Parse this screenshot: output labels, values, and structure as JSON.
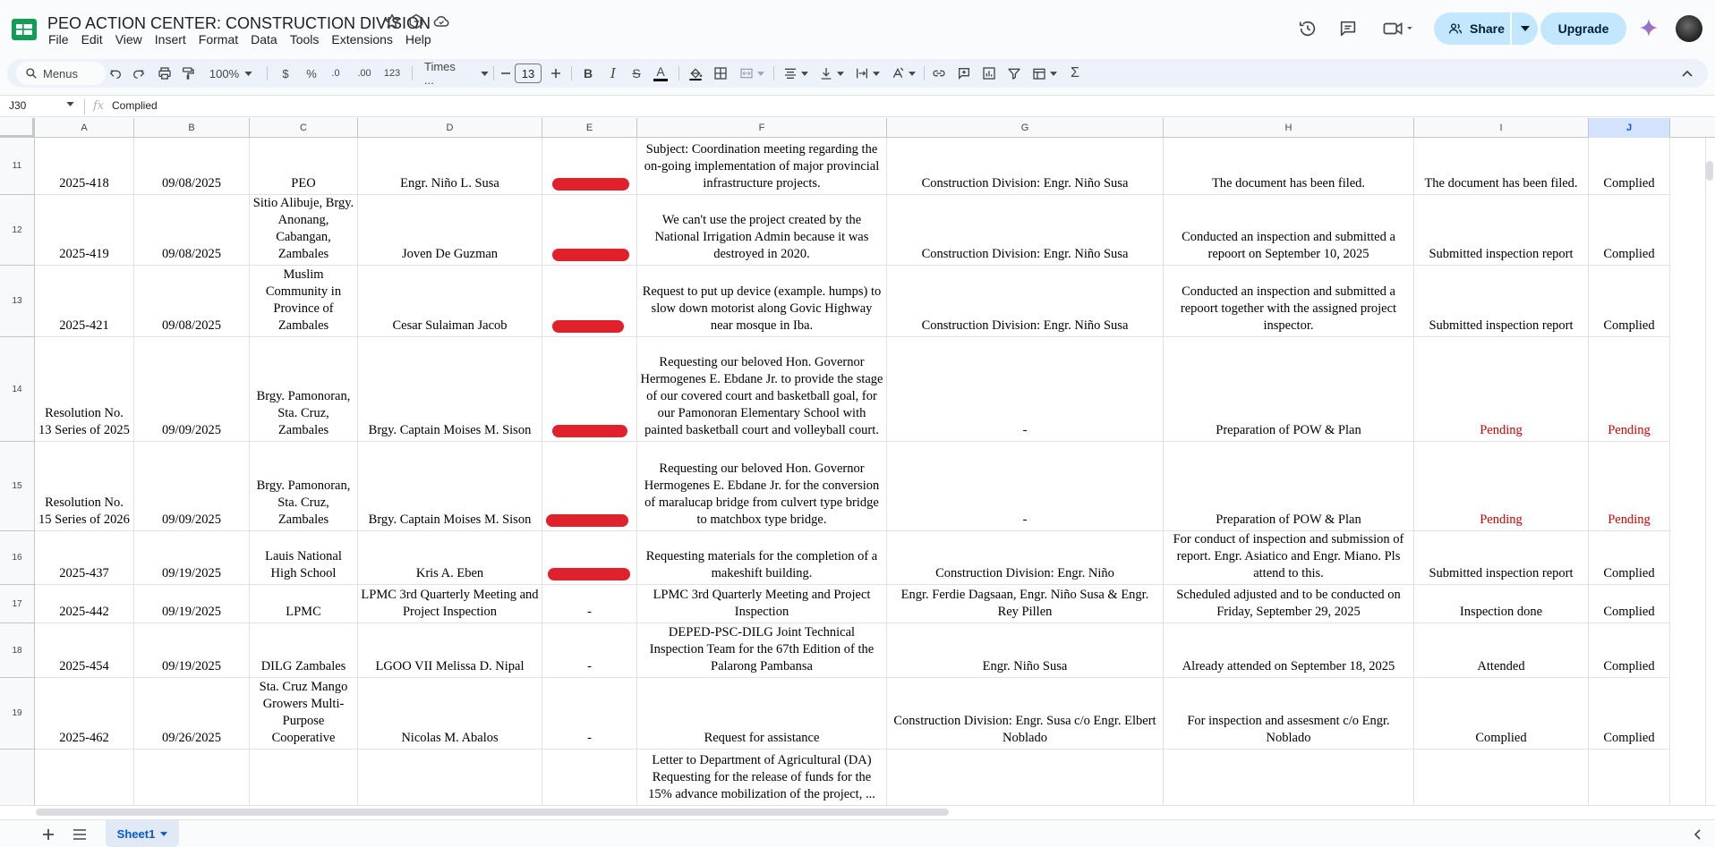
{
  "doc": {
    "title": "PEO ACTION CENTER: CONSTRUCTION DIVISION"
  },
  "menu": [
    "File",
    "Edit",
    "View",
    "Insert",
    "Format",
    "Data",
    "Tools",
    "Extensions",
    "Help"
  ],
  "header": {
    "share_label": "Share",
    "upgrade_label": "Upgrade"
  },
  "toolbar": {
    "menus_label": "Menus",
    "zoom": "100%",
    "currency": "$",
    "percent": "%",
    "dec_decrease": ".0",
    "dec_increase": ".00",
    "number_format": "123",
    "font": "Times ...",
    "font_size": "13",
    "bold": "B",
    "italic": "I",
    "strike": "S",
    "text_color": "A"
  },
  "formula_bar": {
    "cell_ref": "J30",
    "fx": "fx",
    "value": "Complied"
  },
  "columns": [
    "A",
    "B",
    "C",
    "D",
    "E",
    "F",
    "G",
    "H",
    "I",
    "J"
  ],
  "selected_column": "J",
  "rows": [
    {
      "num": "11",
      "cells": [
        "2025-418",
        "09/08/2025",
        "PEO",
        "Engr. Niño L. Susa",
        "",
        "Subject: Coordination meeting regarding the on-going implementation of major provincial infrastructure projects.",
        "Construction Division: Engr. Niño Susa",
        "The document has been filed.",
        "The document has been filed.",
        "Complied"
      ]
    },
    {
      "num": "12",
      "cells": [
        "2025-419",
        "09/08/2025",
        "Sitio Alibuje, Brgy. Anonang, Cabangan, Zambales",
        "Joven De Guzman",
        "",
        "We can't use the project created by the National Irrigation Admin because it was destroyed in 2020.",
        "Construction Division: Engr. Niño Susa",
        "Conducted an inspection and submitted a repoort on September 10, 2025",
        "Submitted inspection report",
        "Complied"
      ]
    },
    {
      "num": "13",
      "cells": [
        "2025-421",
        "09/08/2025",
        "Muslim Community in Province of Zambales",
        "Cesar Sulaiman Jacob",
        "",
        "Request to put up device (example. humps) to slow down motorist along Govic Highway near mosque in Iba.",
        "Construction Division: Engr. Niño Susa",
        "Conducted an inspection and submitted a repoort together with the assigned project inspector.",
        "Submitted inspection report",
        "Complied"
      ]
    },
    {
      "num": "14",
      "cells": [
        "Resolution No. 13 Series of 2025",
        "09/09/2025",
        "Brgy. Pamonoran, Sta. Cruz, Zambales",
        "Brgy. Captain Moises M. Sison",
        "",
        "Requesting our beloved Hon. Governor Hermogenes E. Ebdane Jr. to provide the stage of our covered court and basketball goal, for our Pamonoran Elementary School with painted basketball court and volleyball court.",
        "-",
        "Preparation of POW & Plan",
        "Pending",
        "Pending"
      ]
    },
    {
      "num": "15",
      "cells": [
        "Resolution No. 15 Series of 2026",
        "09/09/2025",
        "Brgy. Pamonoran, Sta. Cruz, Zambales",
        "Brgy. Captain Moises M. Sison",
        "",
        "Requesting our beloved Hon. Governor Hermogenes E. Ebdane Jr. for the conversion of maralucap bridge from culvert type bridge to matchbox type bridge.",
        "-",
        "Preparation of POW & Plan",
        "Pending",
        "Pending"
      ]
    },
    {
      "num": "16",
      "cells": [
        "2025-437",
        "09/19/2025",
        "Lauis National High School",
        "Kris A. Eben",
        "",
        "Requesting materials for the completion of a makeshift building.",
        "Construction Division: Engr. Niño",
        "For conduct of inspection and submission of report. Engr. Asiatico and Engr. Miano. Pls attend to this.",
        "Submitted inspection report",
        "Complied"
      ]
    },
    {
      "num": "17",
      "cells": [
        "2025-442",
        "09/19/2025",
        "LPMC",
        "LPMC 3rd Quarterly Meeting and Project Inspection",
        "-",
        "LPMC 3rd Quarterly Meeting and Project Inspection",
        "Engr. Ferdie Dagsaan, Engr. Niño Susa & Engr. Rey Pillen",
        "Scheduled adjusted and to be conducted on Friday, September 29, 2025",
        "Inspection done",
        "Complied"
      ]
    },
    {
      "num": "18",
      "cells": [
        "2025-454",
        "09/19/2025",
        "DILG Zambales",
        "LGOO VII Melissa D. Nipal",
        "-",
        "DEPED-PSC-DILG Joint Technical Inspection Team for the 67th Edition of the Palarong Pambansa",
        "Engr. Niño Susa",
        "Already attended on September 18, 2025",
        "Attended",
        "Complied"
      ]
    },
    {
      "num": "19",
      "cells": [
        "2025-462",
        "09/26/2025",
        "Sta. Cruz Mango Growers Multi-Purpose Cooperative",
        "Nicolas M. Abalos",
        "-",
        "Request for assistance",
        "Construction Division: Engr. Susa c/o Engr. Elbert Noblado",
        "For inspection and assesment c/o Engr. Noblado",
        "Complied",
        "Complied"
      ]
    },
    {
      "num": "",
      "cells": [
        "",
        "",
        "",
        "",
        "",
        "Letter to Department of Agricultural (DA) Requesting for the release of funds for the 15% advance mobilization of the project, ...",
        "",
        "",
        "",
        ""
      ]
    }
  ],
  "sheet_tab": {
    "label": "Sheet1"
  }
}
